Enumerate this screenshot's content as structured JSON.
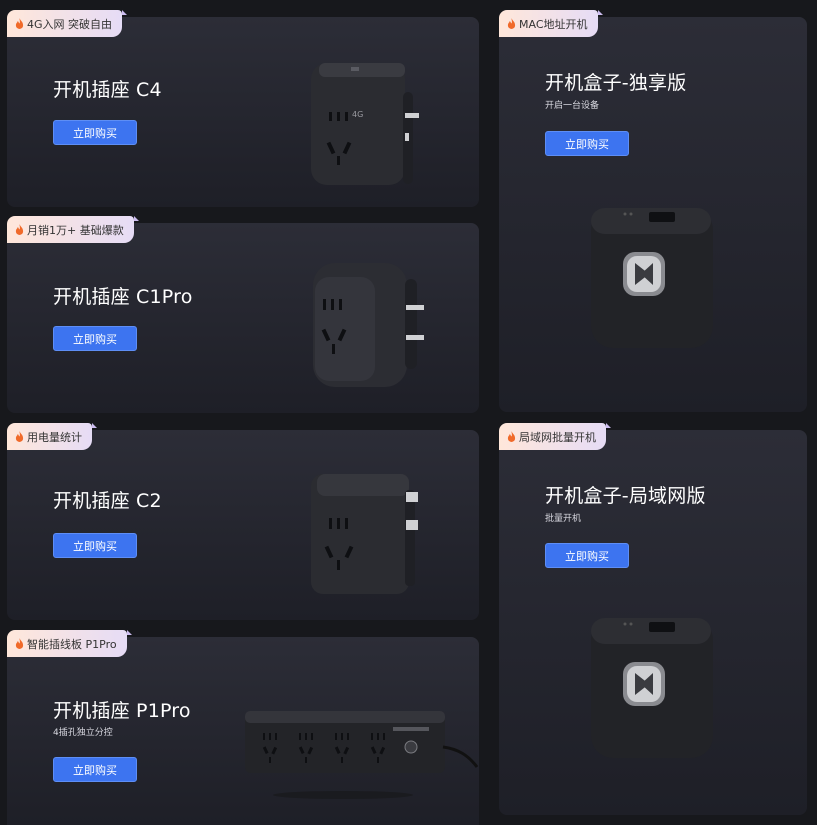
{
  "cards": [
    {
      "badge": "4G入网 突破自由",
      "title": "开机插座 C4",
      "sub": "",
      "button": "立即购买"
    },
    {
      "badge": "月销1万+ 基础爆款",
      "title": "开机插座 C1Pro",
      "sub": "",
      "button": "立即购买"
    },
    {
      "badge": "用电量统计",
      "title": "开机插座 C2",
      "sub": "",
      "button": "立即购买"
    },
    {
      "badge": "智能插线板 P1Pro",
      "title": "开机插座 P1Pro",
      "sub": "4插孔独立分控",
      "button": "立即购买"
    },
    {
      "badge": "MAC地址开机",
      "title": "开机盒子-独享版",
      "sub": "开启一台设备",
      "button": "立即购买"
    },
    {
      "badge": "局域网批量开机",
      "title": "开机盒子-局域网版",
      "sub": "批量开机",
      "button": "立即购买"
    }
  ],
  "icons": {
    "badge_icon": "flame-icon",
    "product_images": [
      "smart-plug-c4",
      "smart-plug-c1pro",
      "smart-plug-c2",
      "power-strip-p1pro",
      "boot-box",
      "boot-box"
    ]
  },
  "colors": {
    "button": "#3d74f0",
    "badge_start": "#ffe7da",
    "badge_end": "#e6dcf6",
    "card": "#2c2d37",
    "page": "#17181c"
  }
}
